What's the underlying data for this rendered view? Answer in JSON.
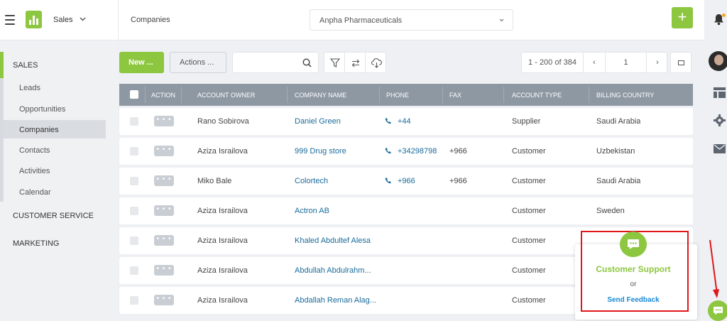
{
  "header": {
    "app_name": "Sales",
    "breadcrumb": "Companies",
    "tenant": "Anpha Pharmaceuticals",
    "add_label": "+"
  },
  "sidebar": {
    "sections": [
      {
        "label": "SALES",
        "items": [
          "Leads",
          "Opportunities",
          "Companies",
          "Contacts",
          "Activities",
          "Calendar"
        ],
        "active_item": "Companies"
      },
      {
        "label": "CUSTOMER SERVICE"
      },
      {
        "label": "MARKETING"
      }
    ]
  },
  "toolbar": {
    "new_label": "New ...",
    "actions_label": "Actions ...",
    "search_value": "",
    "pagination_range": "1 - 200 of 384",
    "page_number": "1",
    "prev_label": "‹",
    "next_label": "›"
  },
  "table": {
    "columns": [
      "ACTION",
      "ACCOUNT OWNER",
      "COMPANY NAME",
      "PHONE",
      "FAX",
      "ACCOUNT TYPE",
      "BILLING COUNTRY"
    ],
    "action_label": "• • •",
    "rows": [
      {
        "owner": "Rano Sobirova",
        "company": "Daniel Green",
        "phone": "+44",
        "fax": "",
        "type": "Supplier",
        "country": "Saudi Arabia"
      },
      {
        "owner": "Aziza Israilova",
        "company": "999 Drug store",
        "phone": "+34298798",
        "fax": "+966",
        "type": "Customer",
        "country": "Uzbekistan"
      },
      {
        "owner": "Miko Bale",
        "company": "Colortech",
        "phone": "+966",
        "fax": "+966",
        "type": "Customer",
        "country": "Saudi Arabia"
      },
      {
        "owner": "Aziza Israilova",
        "company": "Actron AB",
        "phone": "",
        "fax": "",
        "type": "Customer",
        "country": "Sweden"
      },
      {
        "owner": "Aziza Israilova",
        "company": "Khaled Abdultef Alesa",
        "phone": "",
        "fax": "",
        "type": "Customer",
        "country": ""
      },
      {
        "owner": "Aziza Israilova",
        "company": "Abdullah Abdulrahm...",
        "phone": "",
        "fax": "",
        "type": "Customer",
        "country": ""
      },
      {
        "owner": "Aziza Israilova",
        "company": "Abdallah Reman Alag...",
        "phone": "",
        "fax": "",
        "type": "Customer",
        "country": ""
      }
    ]
  },
  "support_popup": {
    "title": "Customer Support",
    "or": "or",
    "feedback": "Send Feedback"
  },
  "colors": {
    "accent": "#8dc63f",
    "link": "#1a6b9a",
    "header": "#8e98a3",
    "highlight": "#e0161b"
  }
}
